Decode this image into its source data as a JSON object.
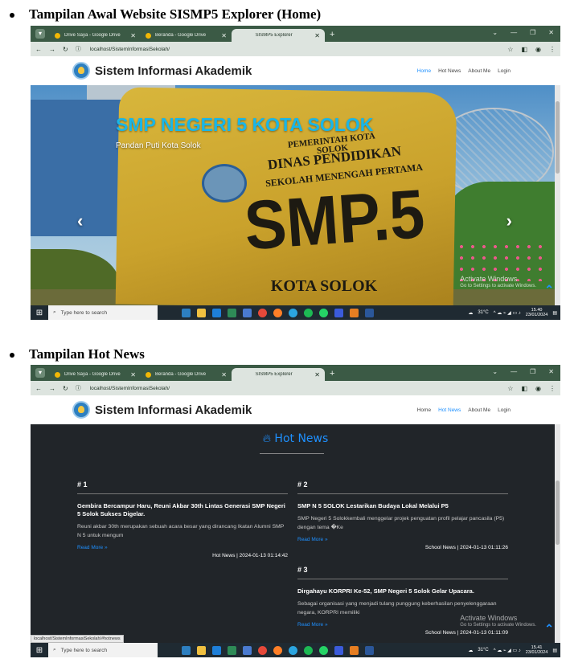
{
  "headings": {
    "home": "Tampilan Awal Website SISMP5 Explorer (Home)",
    "hot": "Tampilan Hot News"
  },
  "browser": {
    "tabs": [
      "Drive Saya - Google Drive",
      "Beranda - Google Drive",
      "SISMP5 Explorer"
    ],
    "url": "localhost/SistemInformasiSekolah/"
  },
  "site": {
    "brand": "Sistem Informasi Akademik",
    "menu": [
      "Home",
      "Hot News",
      "About Me",
      "Login"
    ]
  },
  "hero": {
    "title": "SMP NEGERI 5 KOTA SOLOK",
    "subtitle": "Pandan Puti Kota Solok",
    "sign_line1": "PEMERINTAH KOTA SOLOK",
    "sign_line2": "DINAS PENDIDIKAN",
    "sign_line3": "SEKOLAH MENENGAH PERTAMA",
    "sign_big": "SMP.5",
    "sign_bottom": "KOTA SOLOK"
  },
  "activate": {
    "title": "Activate Windows",
    "sub": "Go to Settings to activate Windows."
  },
  "taskbar": {
    "search_placeholder": "Type here to search",
    "weather": "31°C",
    "shot1_time": "15.40",
    "shot2_time": "15.41",
    "date": "23/01/2024"
  },
  "hot_news": {
    "title": "Hot News",
    "status_url": "localhost/SistemInformasiSekolah/#hotnews",
    "posts": [
      {
        "num": "# 1",
        "title": "Gembira Bercampur Haru, Reuni Akbar 30th Lintas Generasi SMP Negeri 5 Solok Sukses Digelar.",
        "excerpt": "Reuni akbar 30th merupakan sebuah acara besar yang dirancang Ikatan Alumni SMP N 5 untuk mengum",
        "more": "Read More »",
        "meta": "Hot News | 2024-01-13 01:14:42"
      },
      {
        "num": "# 2",
        "title": "SMP N 5 SOLOK Lestarikan Budaya Lokal Melalui P5",
        "excerpt": "SMP Negeri 5 Solokkembali menggelar projek penguatan profil pelajar pancasila (P5) dengan tema �Ke",
        "more": "Read More »",
        "meta": "School News | 2024-01-13 01:11:26"
      },
      {
        "num": "# 3",
        "title": "Dirgahayu KORPRI Ke-52, SMP Negeri 5 Solok Gelar Upacara.",
        "excerpt": "Sebagai organisasi yang menjadi tulang punggung keberhasilan penyelenggaraan negara, KORPRI memiliki",
        "more": "Read More »",
        "meta": "School News | 2024-01-13 01:11:09"
      }
    ]
  }
}
